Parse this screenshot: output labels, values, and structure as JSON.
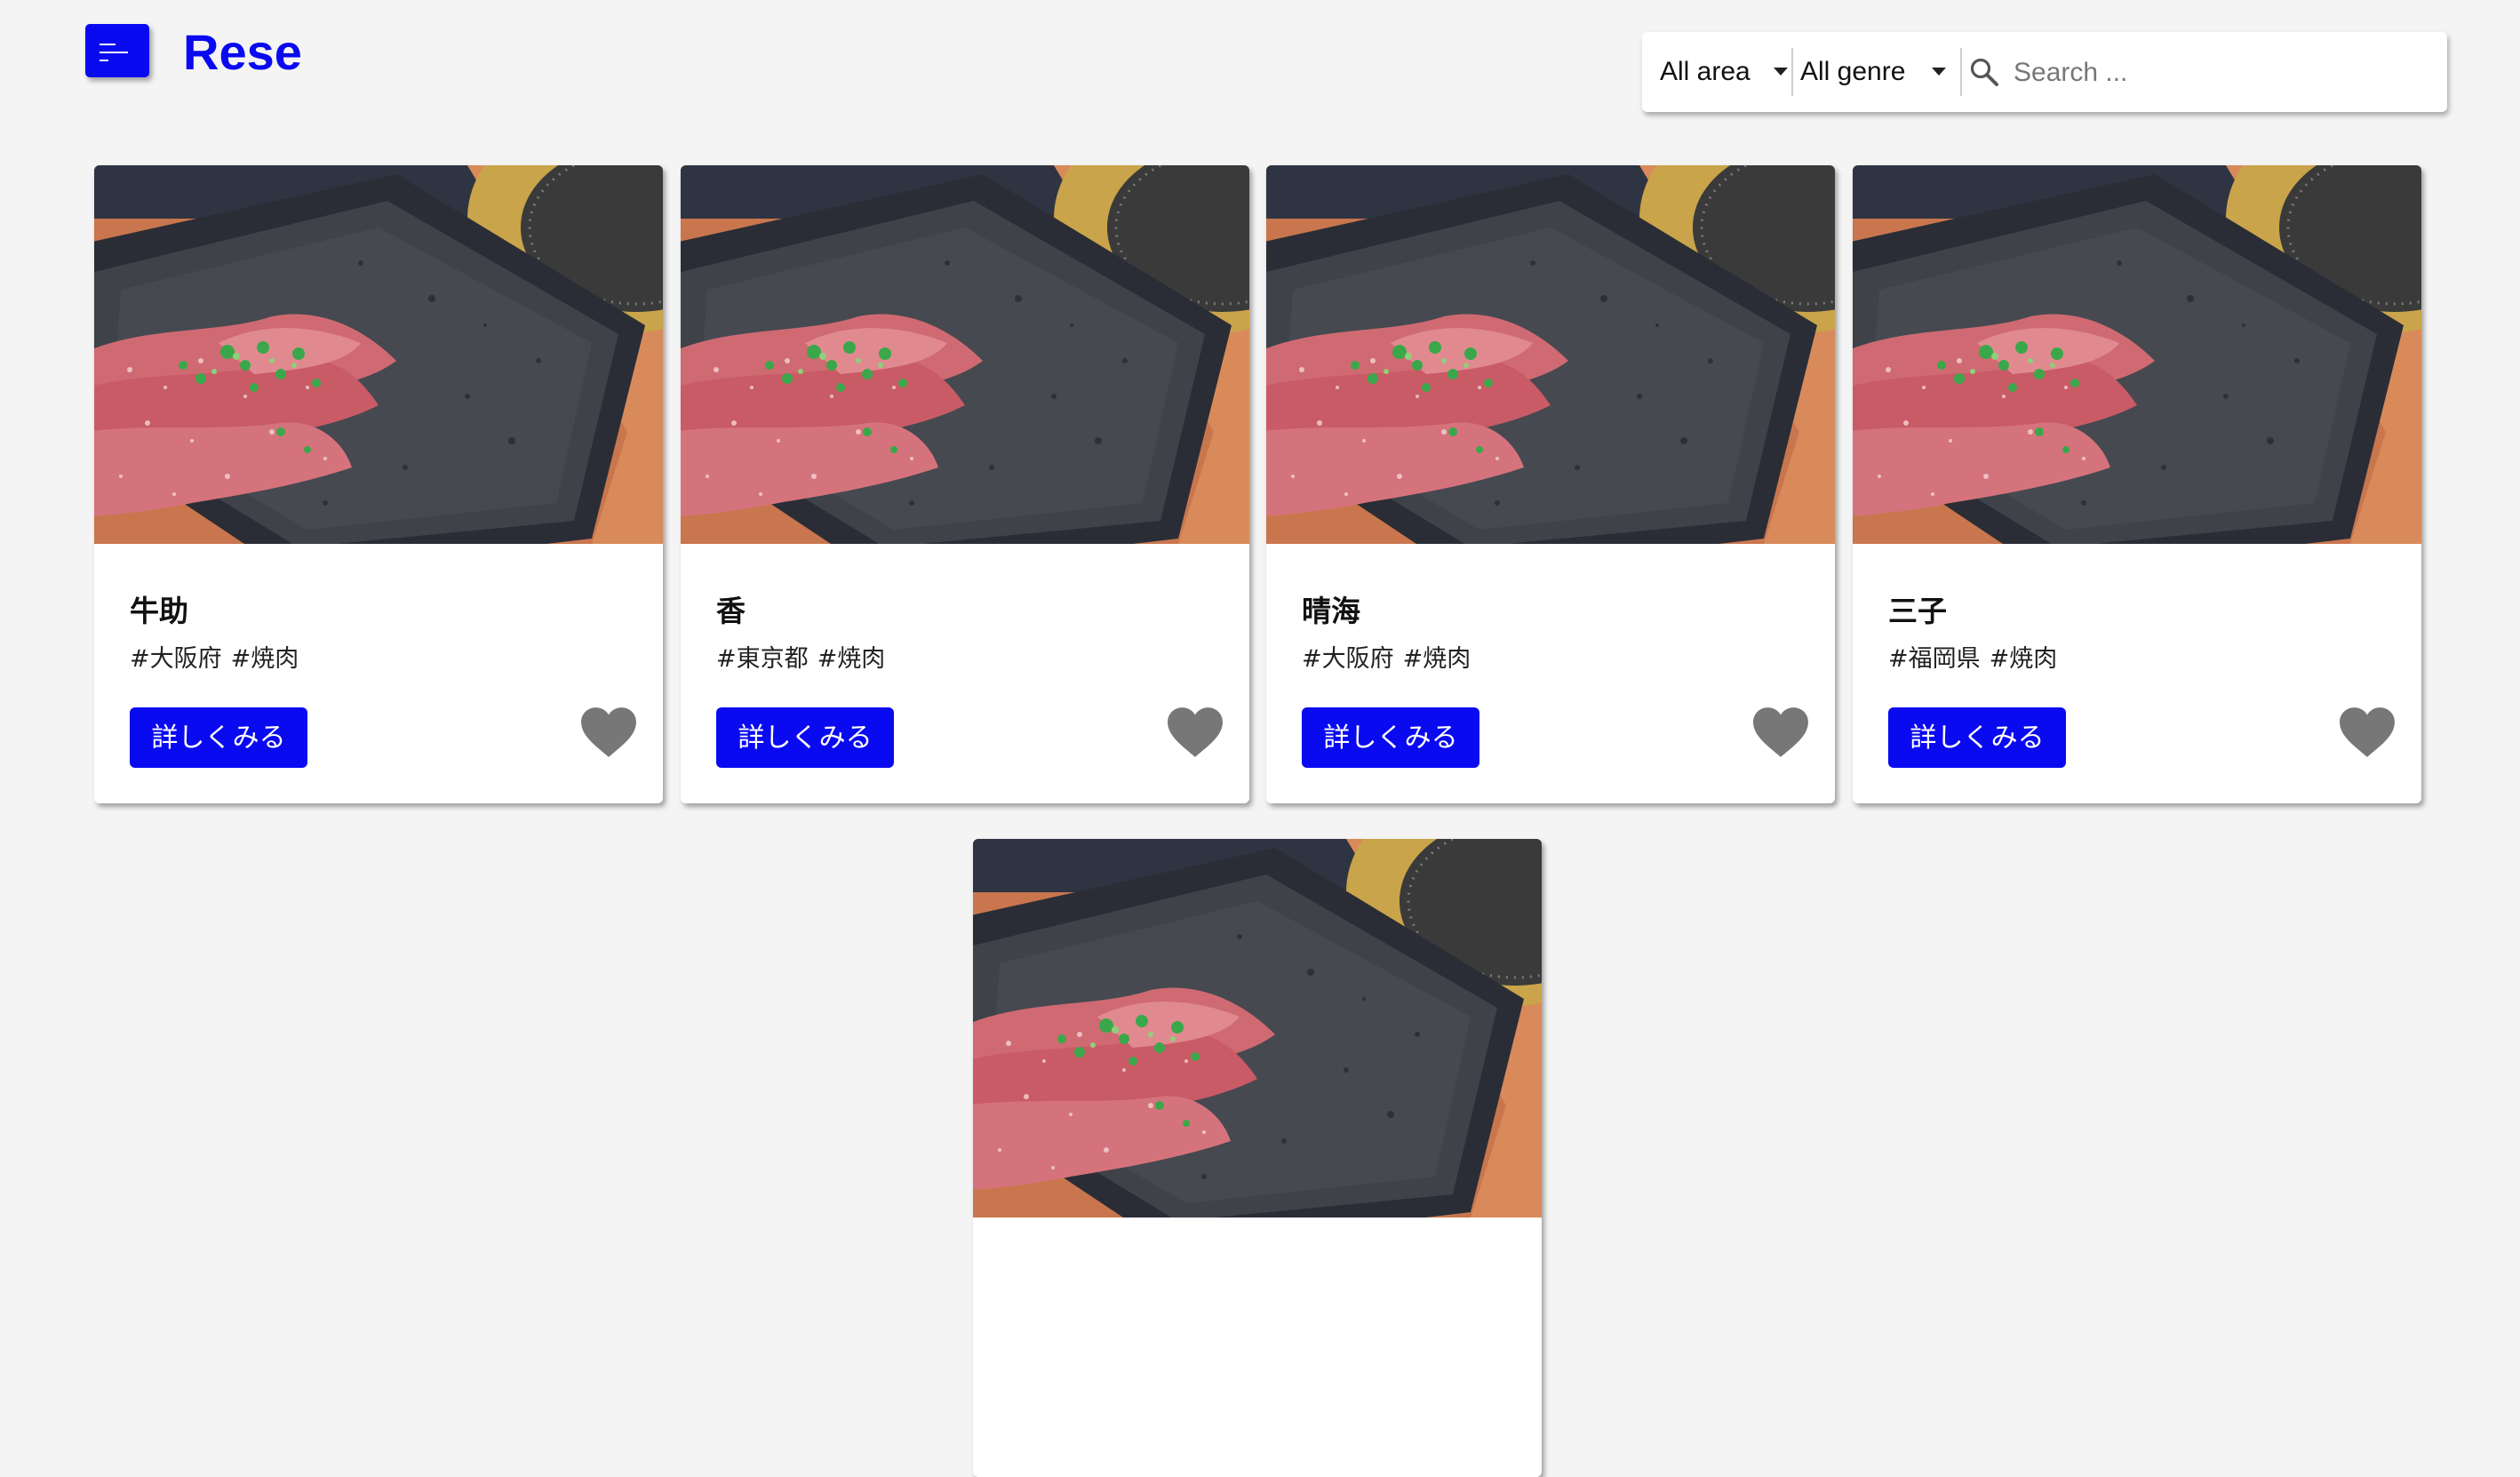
{
  "header": {
    "menu_icon": "hamburger-menu-icon",
    "logo": "Rese"
  },
  "search": {
    "area_value": "All area",
    "genre_value": "All genre",
    "search_icon": "magnifier-icon",
    "placeholder": "Search ..."
  },
  "shops": [
    {
      "name": "牛助",
      "tags": [
        "#大阪府",
        "#焼肉"
      ],
      "detail_label": "詳しくみる",
      "favorite_icon": "heart-icon"
    },
    {
      "name": "香",
      "tags": [
        "#東京都",
        "#焼肉"
      ],
      "detail_label": "詳しくみる",
      "favorite_icon": "heart-icon"
    },
    {
      "name": "晴海",
      "tags": [
        "#大阪府",
        "#焼肉"
      ],
      "detail_label": "詳しくみる",
      "favorite_icon": "heart-icon"
    },
    {
      "name": "三子",
      "tags": [
        "#福岡県",
        "#焼肉"
      ],
      "detail_label": "詳しくみる",
      "favorite_icon": "heart-icon"
    },
    {
      "name": "",
      "tags": [],
      "detail_label": "",
      "favorite_icon": ""
    }
  ],
  "colors": {
    "accent": "#0a0af0",
    "background": "#f4f4f4",
    "heart": "#777777"
  }
}
